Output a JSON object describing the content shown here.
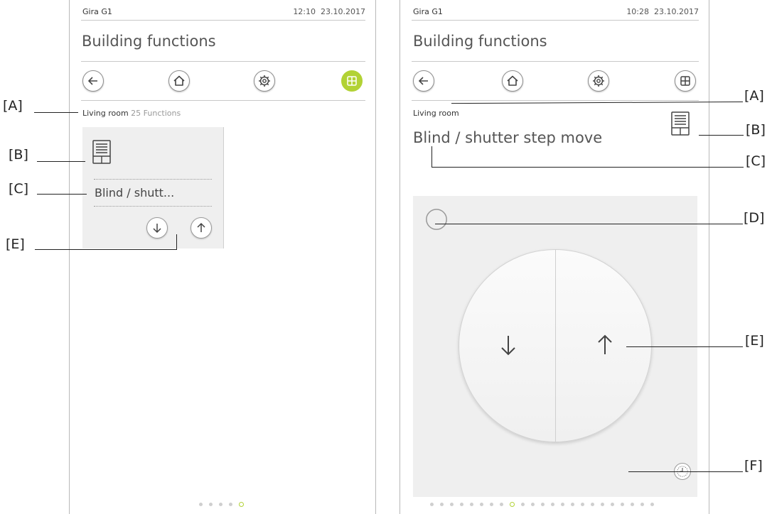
{
  "left": {
    "device_name": "Gira G1",
    "time": "12:10",
    "date": "23.10.2017",
    "title": "Building functions",
    "room": "Living room",
    "function_count": "25",
    "functions_label": "Functions",
    "tile_label": "Blind / shutt...",
    "page_dots_total": 5,
    "page_dots_active": 4
  },
  "right": {
    "device_name": "Gira G1",
    "time": "10:28",
    "date": "23.10.2017",
    "title": "Building functions",
    "room": "Living room",
    "function_title": "Blind / shutter step move",
    "page_dots_total": 23,
    "page_dots_active": 8
  },
  "callouts": {
    "a": "[A]",
    "b": "[B]",
    "c": "[C]",
    "d": "[D]",
    "e": "[E]",
    "f": "[F]"
  },
  "icons": {
    "back": "arrow-left-icon",
    "home": "home-icon",
    "settings": "gear-icon",
    "grid": "grid-icon",
    "blind": "blind-icon",
    "down": "arrow-down-icon",
    "up": "arrow-up-icon",
    "status": "status-ring-icon",
    "timer": "clock-icon"
  },
  "colors": {
    "accent": "#b2d235",
    "tile_bg": "#efefef"
  }
}
